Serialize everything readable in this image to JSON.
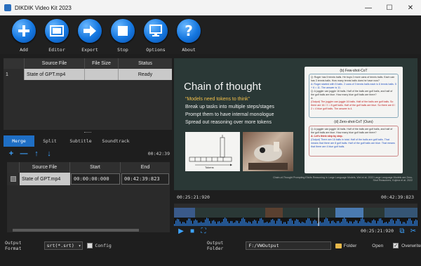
{
  "window": {
    "title": "DIKDIK Video Kit 2023"
  },
  "toolbar": {
    "items": [
      {
        "label": "Add",
        "icon": "plus-icon"
      },
      {
        "label": "Editor",
        "icon": "film-icon"
      },
      {
        "label": "Export",
        "icon": "arrow-right-icon"
      },
      {
        "label": "Stop",
        "icon": "stop-icon"
      },
      {
        "label": "Options",
        "icon": "monitor-icon"
      },
      {
        "label": "About",
        "icon": "question-icon"
      }
    ]
  },
  "filelist": {
    "columns": [
      "Source File",
      "File Size",
      "Status"
    ],
    "rows": [
      {
        "index": "1",
        "file": "State of GPT.mp4",
        "size": "",
        "status": "Ready"
      }
    ]
  },
  "tabs": [
    "Merge",
    "Split",
    "Subtitle",
    "Soundtrack"
  ],
  "segments": {
    "total_duration": "00:42:39",
    "columns": [
      "Source File",
      "Start",
      "End"
    ],
    "rows": [
      {
        "file": "State of GPT.mp4",
        "start": "00:00:00:000",
        "end": "00:42:39:823"
      }
    ]
  },
  "preview": {
    "slide_title": "Chain of thought",
    "lines": [
      "“Models need tokens to think”",
      "Break up tasks into multiple steps/stages",
      "Prompt them to have internal monologue",
      "Spread out reasoning over more tokens"
    ],
    "tokens_label": "Tokens",
    "paper_cap_a": "(b) Few-shot-CoT",
    "paper_cap_b": "(d) Zero-shot-CoT (Ours)",
    "paper_q1": "Q: Roger has 5 tennis balls. He buys 2 more cans of tennis balls. Each can has 3 tennis balls. How many tennis balls does he have now?",
    "paper_a1": "A: Roger started with 5 balls. 2 cans of 3 tennis balls each is 6 tennis balls. 5 + 6 = 11. The answer is 11.",
    "paper_q2": "Q: A juggler can juggle 16 balls. Half of the balls are golf balls, and half of the golf balls are blue. How many blue golf balls are there?",
    "paper_a2_prefix": "A:",
    "paper_out1": "(Output) The juggler can juggle 16 balls. Half of the balls are golf balls. So there are 16 / 2 = 8 golf balls. Half of the golf balls are blue. So there are 8 / 2 = 4 blue golf balls. The answer is 4.",
    "paper_q3": "Q: A juggler can juggle 16 balls. Half of the balls are golf balls, and half of the golf balls are blue. How many blue golf balls are there?",
    "paper_a3": "A: Let's think step by step.",
    "paper_out2": "(Output) There are 16 balls in total. Half of the balls are golf balls. That means that there are 8 golf balls. Half of the golf balls are blue. That means that there are 4 blue golf balls.",
    "cite": "Chain-of-Thought Prompting Elicits Reasoning in Large Language Models, Wei et al. 2022\nLarge Language Models are Zero-Shot Reasoners, Kojima et al. 2022"
  },
  "timeline": {
    "current": "00:25:21:920",
    "total": "00:42:39:823",
    "position_fraction": 0.594,
    "play_time": "00:25:21:920"
  },
  "bottom": {
    "format_label": "Output Format",
    "format_value": "srt(*.srt)",
    "config_label": "Config",
    "folder_label": "Output Folder",
    "folder_value": "F:/VWOutput",
    "folder_btn": "Folder",
    "open_label": "Open",
    "overwrite_label": "Overwrite"
  },
  "colors": {
    "accent": "#1f6fc5",
    "toolbar_icon": "#1577e0",
    "slide_bg": "#2a3836",
    "slide_quote": "#f3c14a"
  }
}
